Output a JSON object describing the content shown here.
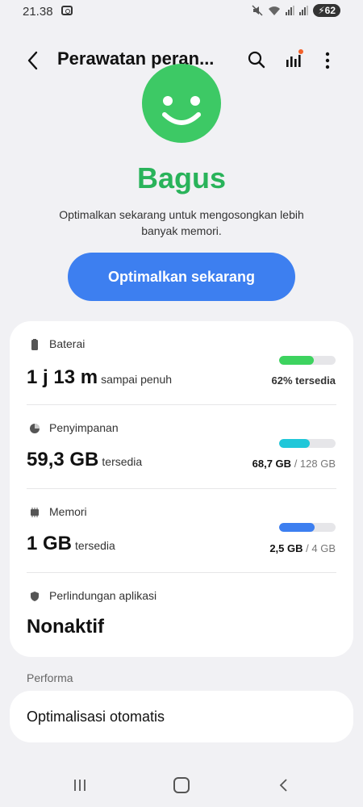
{
  "statusbar": {
    "time": "21.38",
    "battery": "62"
  },
  "header": {
    "title": "Perawatan peran..."
  },
  "status": {
    "label": "Bagus",
    "description": "Optimalkan sekarang untuk mengosongkan lebih banyak memori."
  },
  "optimize_button": "Optimalkan sekarang",
  "battery": {
    "label": "Baterai",
    "value": "1 j 13 m",
    "suffix": "sampai penuh",
    "right": "62% tersedia",
    "level": 0.62,
    "color": "#3dd35f"
  },
  "storage": {
    "label": "Penyimpanan",
    "value": "59,3 GB",
    "suffix": "tersedia",
    "used": "68,7 GB",
    "total": "/ 128 GB",
    "level": 0.54,
    "color": "#20c7d9"
  },
  "memory": {
    "label": "Memori",
    "value": "1 GB",
    "suffix": "tersedia",
    "used": "2,5 GB",
    "total": "/ 4 GB",
    "level": 0.63,
    "color": "#3d7ff0"
  },
  "app_protection": {
    "label": "Perlindungan aplikasi",
    "value": "Nonaktif"
  },
  "performance": {
    "section": "Performa",
    "auto_optimize": "Optimalisasi otomatis"
  },
  "colors": {
    "accent": "#3d7ff0",
    "good": "#29b35a"
  }
}
